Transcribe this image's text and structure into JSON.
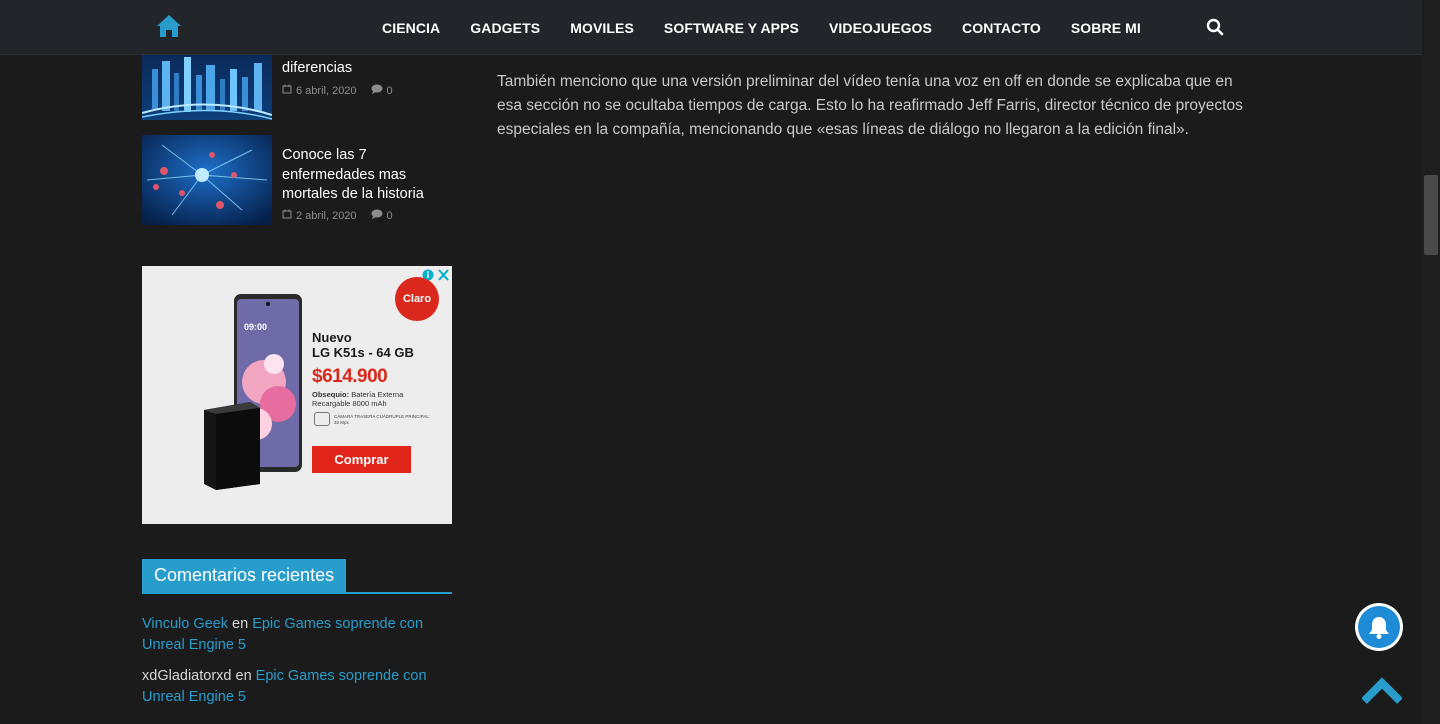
{
  "nav": {
    "items": [
      "CIENCIA",
      "GADGETS",
      "MOVILES",
      "SOFTWARE Y APPS",
      "VIDEOJUEGOS",
      "CONTACTO",
      "SOBRE MI"
    ]
  },
  "sidebar": {
    "posts": [
      {
        "title": "diferencias",
        "date": "6 abril, 2020",
        "comments": "0"
      },
      {
        "title": "Conoce las 7 enfermedades mas mortales de la historia",
        "date": "2 abril, 2020",
        "comments": "0"
      }
    ],
    "ad": {
      "brand": "Claro",
      "title_line1": "Nuevo",
      "title_line2": "LG K51s - 64 GB",
      "price": "$614.900",
      "gift_label": "Obsequio:",
      "gift_text": "Batería Externa Recargable 8000 mAh",
      "camera_text": "CÁMARA TRASERA CUÁDRUPLE PRINCIPAL: 32 Mpx",
      "phone_time": "09:00",
      "cta": "Comprar"
    },
    "recent_comments_title": "Comentarios recientes",
    "recent_comments": [
      {
        "author": "Vinculo Geek",
        "connector": "en",
        "post": "Epic Games soprende con Unreal Engine 5"
      },
      {
        "author": "xdGladiatorxd",
        "connector": "en",
        "post": "Epic Games soprende con Unreal Engine 5"
      }
    ]
  },
  "article": {
    "paragraph": "También menciono que una versión preliminar del vídeo tenía una voz en off en donde se explicaba que en esa sección no se ocultaba tiempos de carga. Esto lo ha reafirmado Jeff Farris, director técnico de proyectos especiales en la compañía, mencionando que «esas líneas de diálogo no llegaron a la edición final»."
  },
  "colors": {
    "accent": "#289dcc",
    "navbar": "#22262a",
    "background": "#1b1b1b",
    "ad_red": "#da291c"
  },
  "icons": [
    "home-icon",
    "search-icon",
    "calendar-icon",
    "comment-icon",
    "bell-icon",
    "chevron-up-icon",
    "ad-info-icon",
    "ad-close-icon"
  ]
}
